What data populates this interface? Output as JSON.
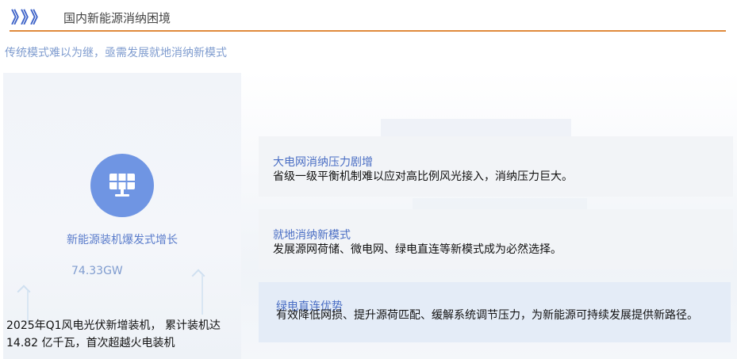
{
  "header": {
    "chevrons": "》》》",
    "title": "国内新能源消纳困境"
  },
  "subtitle": "传统模式难以为继，亟需发展就地消纳新模式",
  "left_card": {
    "icon": "solar-panel-icon",
    "label": "新能源装机爆发式增长",
    "value": "74.33GW",
    "note": "2025年Q1风电光伏新增装机， 累计装机达14.82 亿千瓦，首次超越火电装机"
  },
  "info_boxes": [
    {
      "title": "大电网消纳压力剧增",
      "body": "省级一级平衡机制难以应对高比例风光接入，消纳压力巨大。"
    },
    {
      "title": "就地消纳新模式",
      "body": "发展源网荷储、微电网、绿电直连等新模式成为必然选择。"
    },
    {
      "title": "绿电直连优势",
      "body": "有效降低网损、提升源荷匹配、缓解系统调节压力，为新能源可持续发展提供新路径。"
    }
  ],
  "colors": {
    "accent_blue": "#3f64c8",
    "rule_orange": "#e08a3c",
    "icon_circle": "#6f95e3"
  }
}
